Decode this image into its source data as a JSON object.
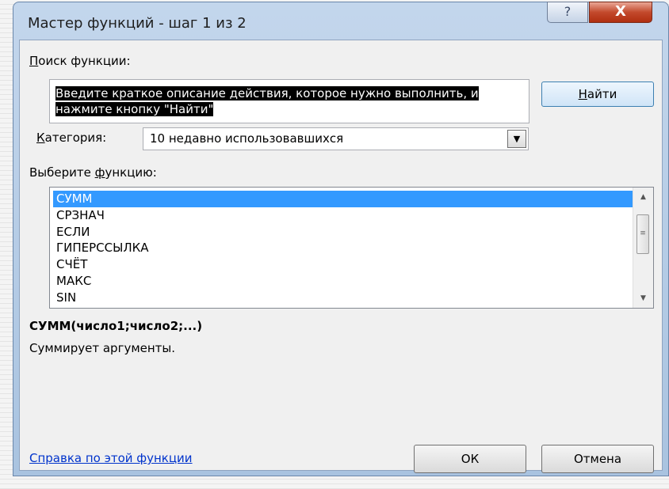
{
  "window": {
    "title": "Мастер функций - шаг 1 из 2",
    "help_button": "?",
    "close_button": "X"
  },
  "search": {
    "label_accel": "П",
    "label_rest": "оиск функции:",
    "text": "Введите краткое описание действия, которое нужно выполнить, и нажмите кнопку \"Найти\"",
    "find_button_accel": "Н",
    "find_button_rest": "айти"
  },
  "category": {
    "label_accel": "К",
    "label_rest": "атегория:",
    "value": "10 недавно использовавшихся"
  },
  "functions": {
    "label_pre": "Выберите ",
    "label_accel": "ф",
    "label_rest": "ункцию:",
    "items": [
      "СУММ",
      "СРЗНАЧ",
      "ЕСЛИ",
      "ГИПЕРССЫЛКА",
      "СЧЁТ",
      "МАКС",
      "SIN"
    ],
    "selected_index": 0
  },
  "details": {
    "signature": "СУММ(число1;число2;...)",
    "description": "Суммирует аргументы."
  },
  "footer": {
    "help_link": "Справка по этой функции",
    "ok_button": "ОК",
    "cancel_button": "Отмена"
  },
  "colors": {
    "selection": "#3399ff",
    "link": "#0033cc",
    "close_button": "#c3492c"
  },
  "icons": {
    "dropdown": "chevron-down-icon",
    "scroll_up": "arrow-up-icon",
    "scroll_down": "arrow-down-icon"
  }
}
